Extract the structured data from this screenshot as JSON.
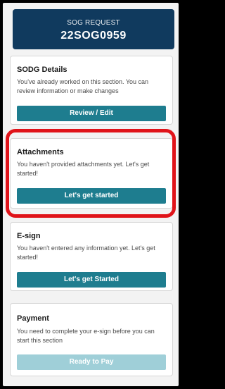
{
  "header": {
    "label": "SOG REQUEST",
    "request_id": "22SOG0959",
    "bg_color": "#103a5e"
  },
  "sections": [
    {
      "title": "SODG Details",
      "description": "You've already worked on this section. You can review information or make changes",
      "button_label": "Review / Edit",
      "button_state": "enabled"
    },
    {
      "title": "Attachments",
      "description": "You haven't provided attachments yet. Let's get started!",
      "button_label": "Let's get started",
      "button_state": "enabled",
      "highlighted": true
    },
    {
      "title": "E-sign",
      "description": "You haven't entered any information yet. Let's get started!",
      "button_label": "Let's get Started",
      "button_state": "enabled"
    },
    {
      "title": "Payment",
      "description": "You need to complete your e-sign before you can start this section",
      "button_label": "Ready to Pay",
      "button_state": "disabled"
    }
  ],
  "colors": {
    "button_primary": "#1e7d8f",
    "button_disabled": "#9fcfd8",
    "highlight": "#e0141a"
  }
}
